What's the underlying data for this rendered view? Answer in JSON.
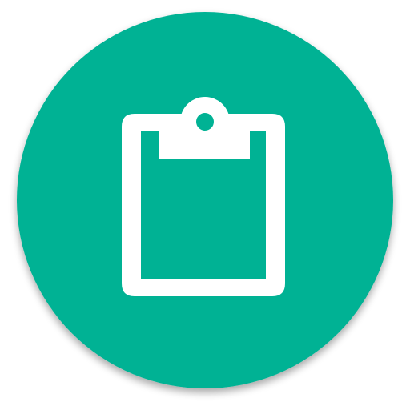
{
  "app_icon": {
    "icon": "clipboard-icon",
    "background_color": "#00b294",
    "glyph_color": "#ffffff"
  }
}
